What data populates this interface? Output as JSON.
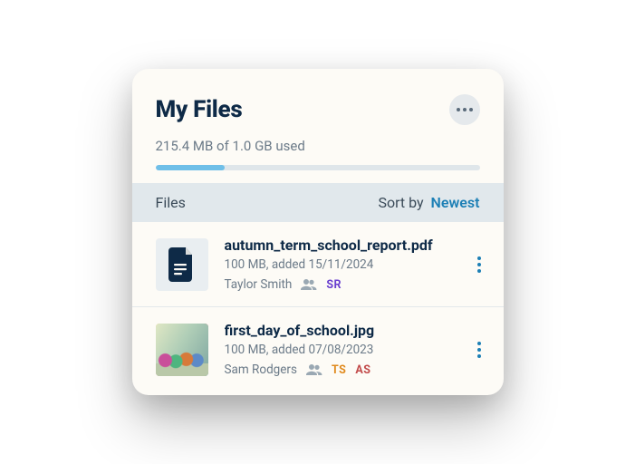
{
  "header": {
    "title": "My Files",
    "storage_text": "215.4 MB of 1.0 GB used",
    "storage_percent": 21.5
  },
  "subheader": {
    "files_label": "Files",
    "sort_label": "Sort by",
    "sort_value": "Newest"
  },
  "files": [
    {
      "name": "autumn_term_school_report.pdf",
      "meta": "100 MB, added  15/11/2024",
      "owner": "Taylor Smith",
      "shared": [
        {
          "initials": "SR",
          "color": "i-purple"
        }
      ],
      "thumb": "doc"
    },
    {
      "name": "first_day_of_school.jpg",
      "meta": "100 MB, added 07/08/2023",
      "owner": "Sam Rodgers",
      "shared": [
        {
          "initials": "TS",
          "color": "i-orange"
        },
        {
          "initials": "AS",
          "color": "i-red"
        }
      ],
      "thumb": "photo"
    }
  ]
}
